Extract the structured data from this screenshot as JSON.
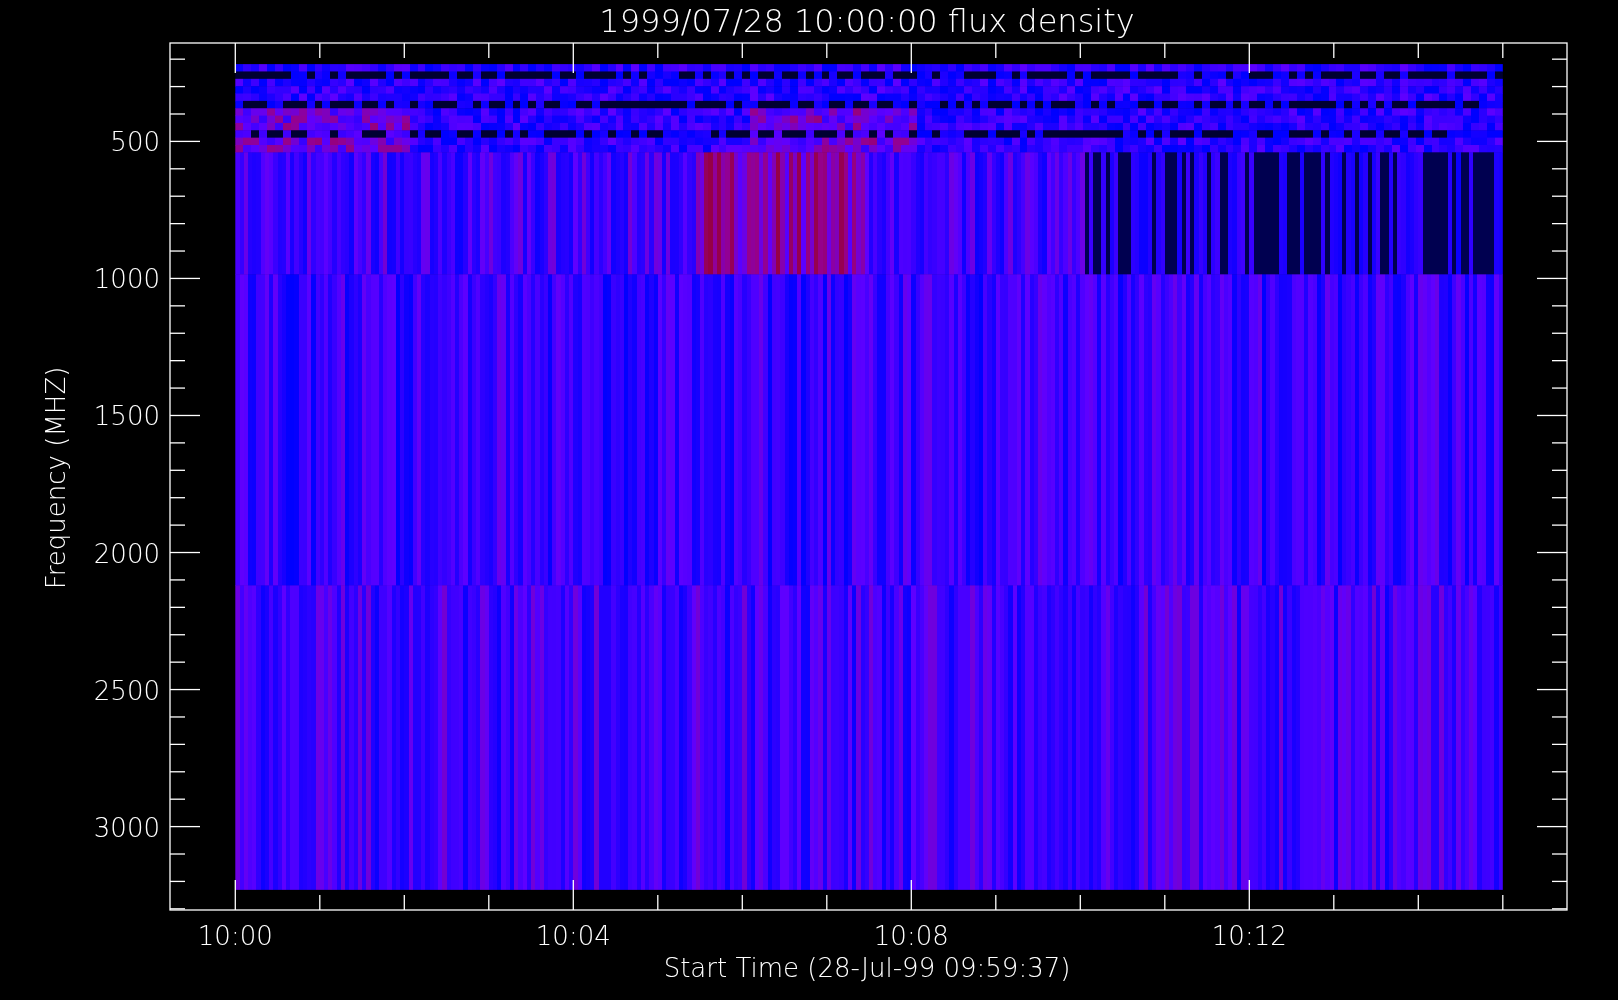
{
  "plot": {
    "title": "1999/07/28 10:00:00 flux density",
    "xlabel": "Start Time (28-Jul-99 09:59:37)",
    "ylabel": "Frequency (MHZ)",
    "xticks": [
      "10:00",
      "10:04",
      "10:08",
      "10:12"
    ],
    "yticks": [
      "500",
      "1000",
      "1500",
      "2000",
      "2500",
      "3000"
    ]
  }
}
